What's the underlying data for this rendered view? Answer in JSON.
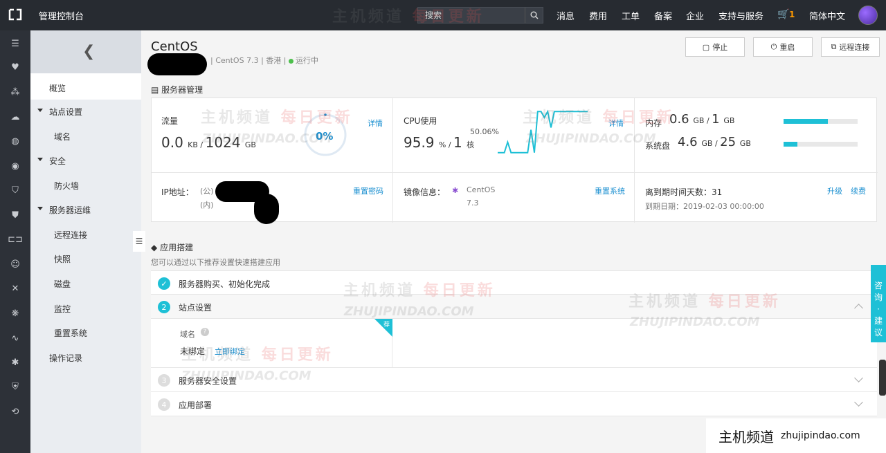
{
  "topbar": {
    "title": "管理控制台",
    "search_placeholder": "搜索",
    "nav": [
      "消息",
      "费用",
      "工单",
      "备案",
      "企业",
      "支持与服务"
    ],
    "cart_count": "1",
    "language": "简体中文"
  },
  "sidebar": {
    "items": [
      {
        "label": "概览"
      },
      {
        "label": "站点设置"
      },
      {
        "label": "域名"
      },
      {
        "label": "安全"
      },
      {
        "label": "防火墙"
      },
      {
        "label": "服务器运维"
      },
      {
        "label": "远程连接"
      },
      {
        "label": "快照"
      },
      {
        "label": "磁盘"
      },
      {
        "label": "监控"
      },
      {
        "label": "重置系统"
      },
      {
        "label": "操作记录"
      }
    ]
  },
  "header": {
    "title": "CentOS",
    "os": "CentOS 7.3",
    "region": "香港",
    "status": "运行中",
    "buttons": {
      "stop": "停止",
      "restart": "重启",
      "remote": "远程连接"
    }
  },
  "server_mgmt": {
    "title": "服务器管理",
    "traffic": {
      "label": "流量",
      "used": "0.0",
      "used_unit": "KB",
      "total": "1024",
      "total_unit": "GB",
      "percent": "0%",
      "detail": "详情"
    },
    "cpu": {
      "label": "CPU使用",
      "value": "95.9",
      "unit": "%",
      "cores": "1",
      "cores_unit": "核",
      "peak": "50.06%",
      "detail": "详情",
      "samples": [
        5,
        5,
        5,
        28,
        5,
        5,
        5,
        5,
        5,
        5,
        55,
        5,
        95,
        95,
        82,
        95,
        60,
        95,
        95,
        95,
        95,
        95,
        95,
        95,
        95,
        95,
        95,
        95
      ]
    },
    "memory": {
      "label": "内存",
      "used": "0.6",
      "used_unit": "GB",
      "total": "1",
      "total_unit": "GB",
      "fraction": 0.6
    },
    "disk": {
      "label": "系统盘",
      "used": "4.6",
      "used_unit": "GB",
      "total": "25",
      "total_unit": "GB",
      "fraction": 0.184
    },
    "ip": {
      "label": "IP地址：",
      "public": "(公)",
      "private": "(内)",
      "reset_password": "重置密码"
    },
    "image": {
      "label": "镜像信息：",
      "name": "CentOS",
      "version": "7.3",
      "reset_system": "重置系统"
    },
    "expiry": {
      "label": "离到期时间天数：",
      "days": "31",
      "date_label": "到期日期：",
      "date": "2019-02-03 00:00:00",
      "upgrade": "升级",
      "renew": "续费"
    }
  },
  "app_build": {
    "title": "应用搭建",
    "subtitle": "您可以通过以下推荐设置快速搭建应用",
    "steps": [
      {
        "num": "✓",
        "label": "服务器购买、初始化完成"
      },
      {
        "num": "2",
        "label": "站点设置"
      },
      {
        "num": "3",
        "label": "服务器安全设置"
      },
      {
        "num": "4",
        "label": "应用部署"
      }
    ],
    "domain": {
      "label": "域名",
      "status": "未绑定",
      "action": "立即绑定",
      "badge": "荐"
    }
  },
  "watermark": {
    "cn": "主机频道",
    "cn_red": "每日更新",
    "en": "ZHUJIPINDAO.COM"
  },
  "feedback": [
    "咨",
    "询",
    "·",
    "建",
    "议"
  ],
  "brand": {
    "cn": "主机频道",
    "en": "zhujipindao.com"
  }
}
